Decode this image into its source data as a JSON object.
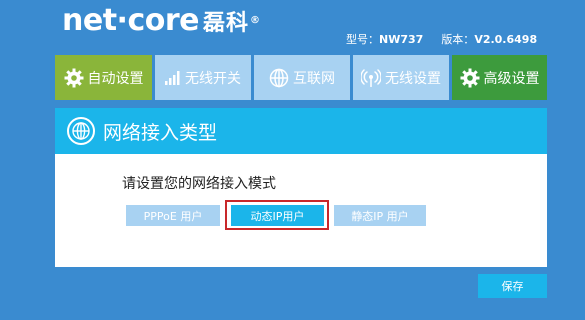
{
  "brand": {
    "logo_text": "net·core",
    "logo_cn": "磊科",
    "registered": "®"
  },
  "model": {
    "model_label": "型号：",
    "model_value": "NW737",
    "version_label": "版本：",
    "version_value": "V2.0.6498"
  },
  "tabs": [
    {
      "label": "自动设置",
      "icon": "gear-icon"
    },
    {
      "label": "无线开关",
      "icon": "signal-bars-icon"
    },
    {
      "label": "互联网",
      "icon": "globe-icon"
    },
    {
      "label": "无线设置",
      "icon": "wireless-icon"
    },
    {
      "label": "高级设置",
      "icon": "gear-icon"
    }
  ],
  "panel": {
    "title": "网络接入类型",
    "prompt": "请设置您的网络接入模式",
    "modes": [
      {
        "label": "PPPoE 用户"
      },
      {
        "label": "动态IP用户"
      },
      {
        "label": "静态IP 用户"
      }
    ],
    "selected_mode": "动态IP用户"
  },
  "actions": {
    "save_label": "保存"
  },
  "colors": {
    "background": "#3a8bd0",
    "tab_auto": "#8ab53a",
    "tab_inactive": "#a8d2f2",
    "tab_advanced": "#3d9b3d",
    "accent": "#1bb5ea",
    "highlight_border": "#c8282a"
  }
}
